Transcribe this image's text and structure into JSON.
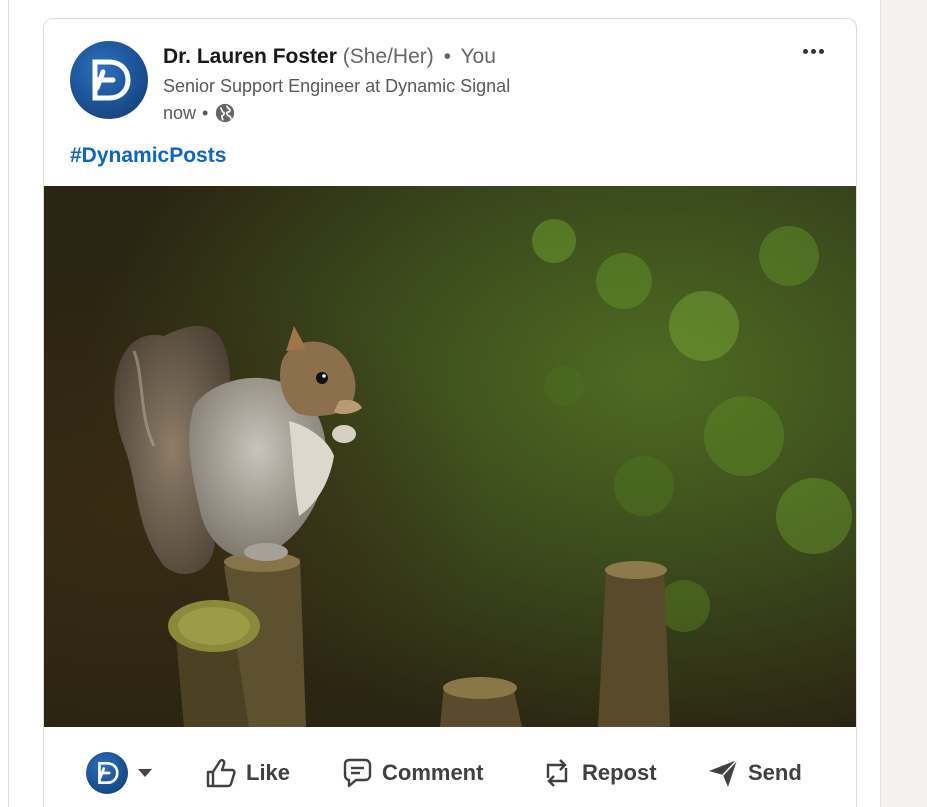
{
  "post": {
    "author_name": "Dr. Lauren Foster",
    "pronouns": "(She/Her)",
    "separator": "•",
    "connection": "You",
    "headline": "Senior Support Engineer at Dynamic Signal",
    "time": "now",
    "time_separator": "•",
    "visibility_icon": "globe-icon",
    "hashtag": "#DynamicPosts",
    "image_subject": "squirrel-photo"
  },
  "actions": {
    "like_label": "Like",
    "comment_label": "Comment",
    "repost_label": "Repost",
    "send_label": "Send"
  },
  "colors": {
    "hashtag": "#0a66c2",
    "brand": "#1a4f8f",
    "action_text": "#404040"
  }
}
